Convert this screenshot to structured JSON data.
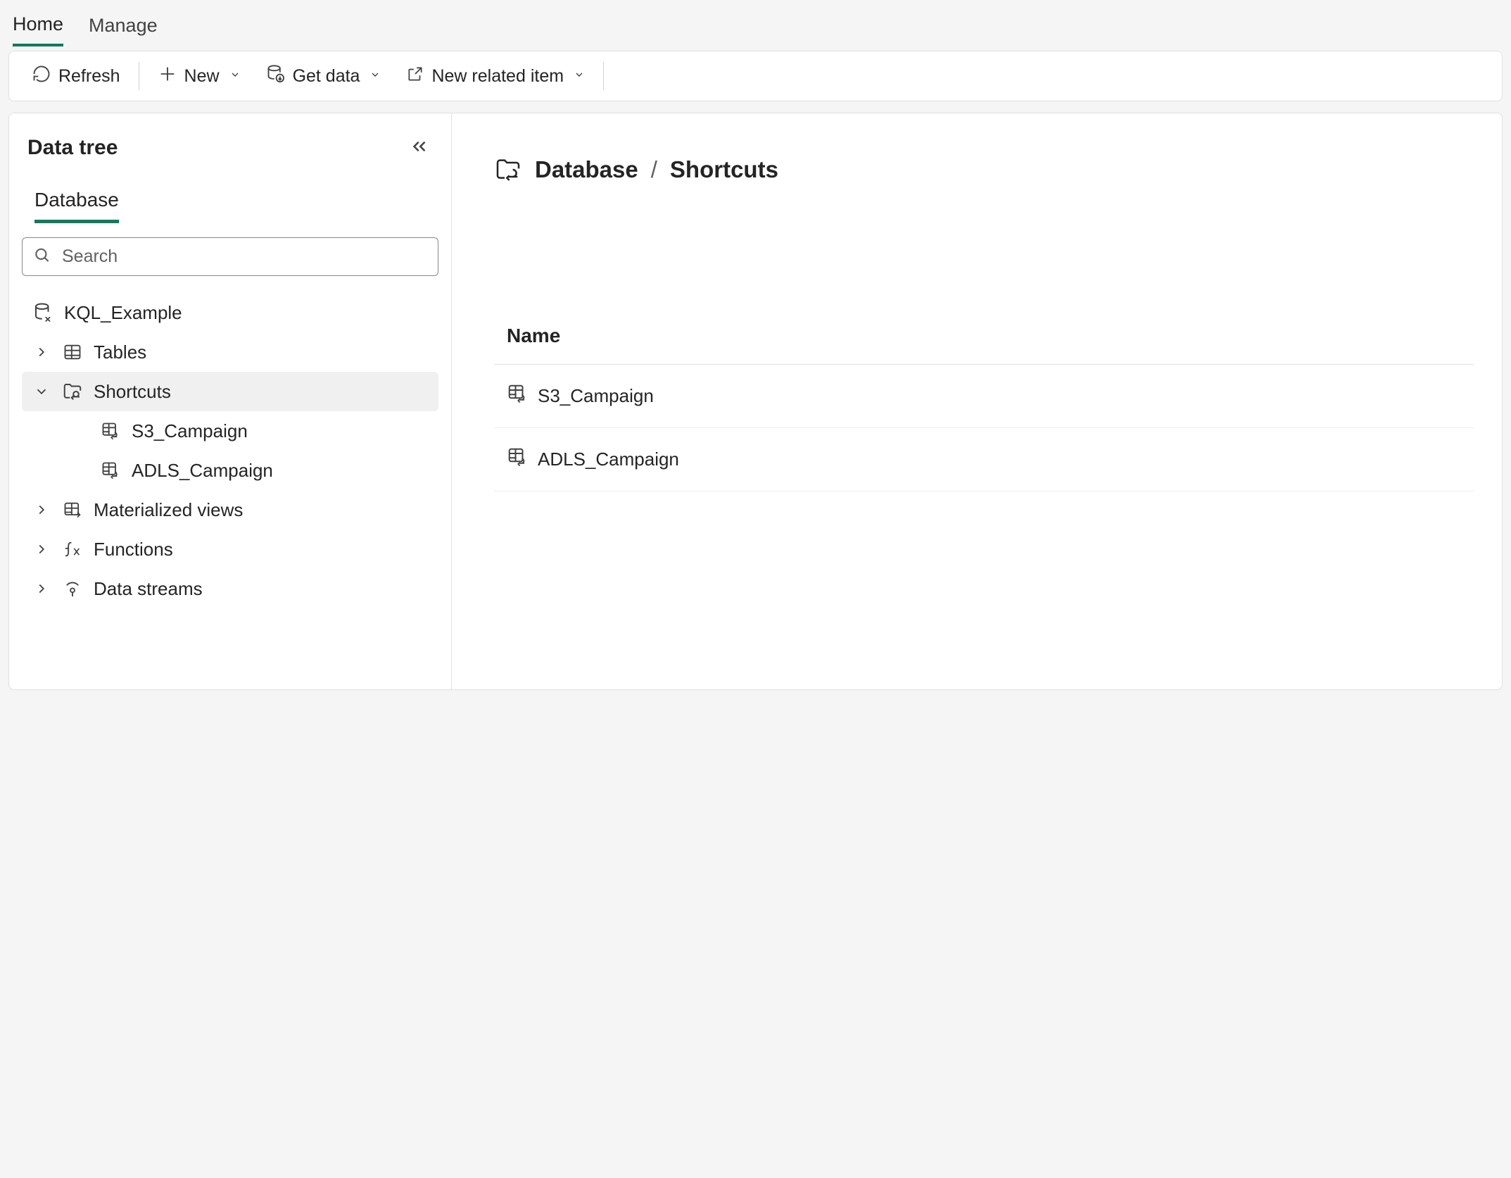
{
  "tabs": {
    "home": "Home",
    "manage": "Manage"
  },
  "toolbar": {
    "refresh": "Refresh",
    "new": "New",
    "get_data": "Get data",
    "new_related": "New related item"
  },
  "sidebar": {
    "title": "Data tree",
    "db_tab": "Database",
    "search_placeholder": "Search",
    "database": "KQL_Example",
    "nodes": {
      "tables": "Tables",
      "shortcuts": "Shortcuts",
      "shortcut_items": [
        "S3_Campaign",
        "ADLS_Campaign"
      ],
      "materialized": "Materialized views",
      "functions": "Functions",
      "data_streams": "Data streams"
    }
  },
  "main": {
    "breadcrumb": {
      "db": "Database",
      "current": "Shortcuts"
    },
    "column_name": "Name",
    "rows": [
      "S3_Campaign",
      "ADLS_Campaign"
    ]
  }
}
